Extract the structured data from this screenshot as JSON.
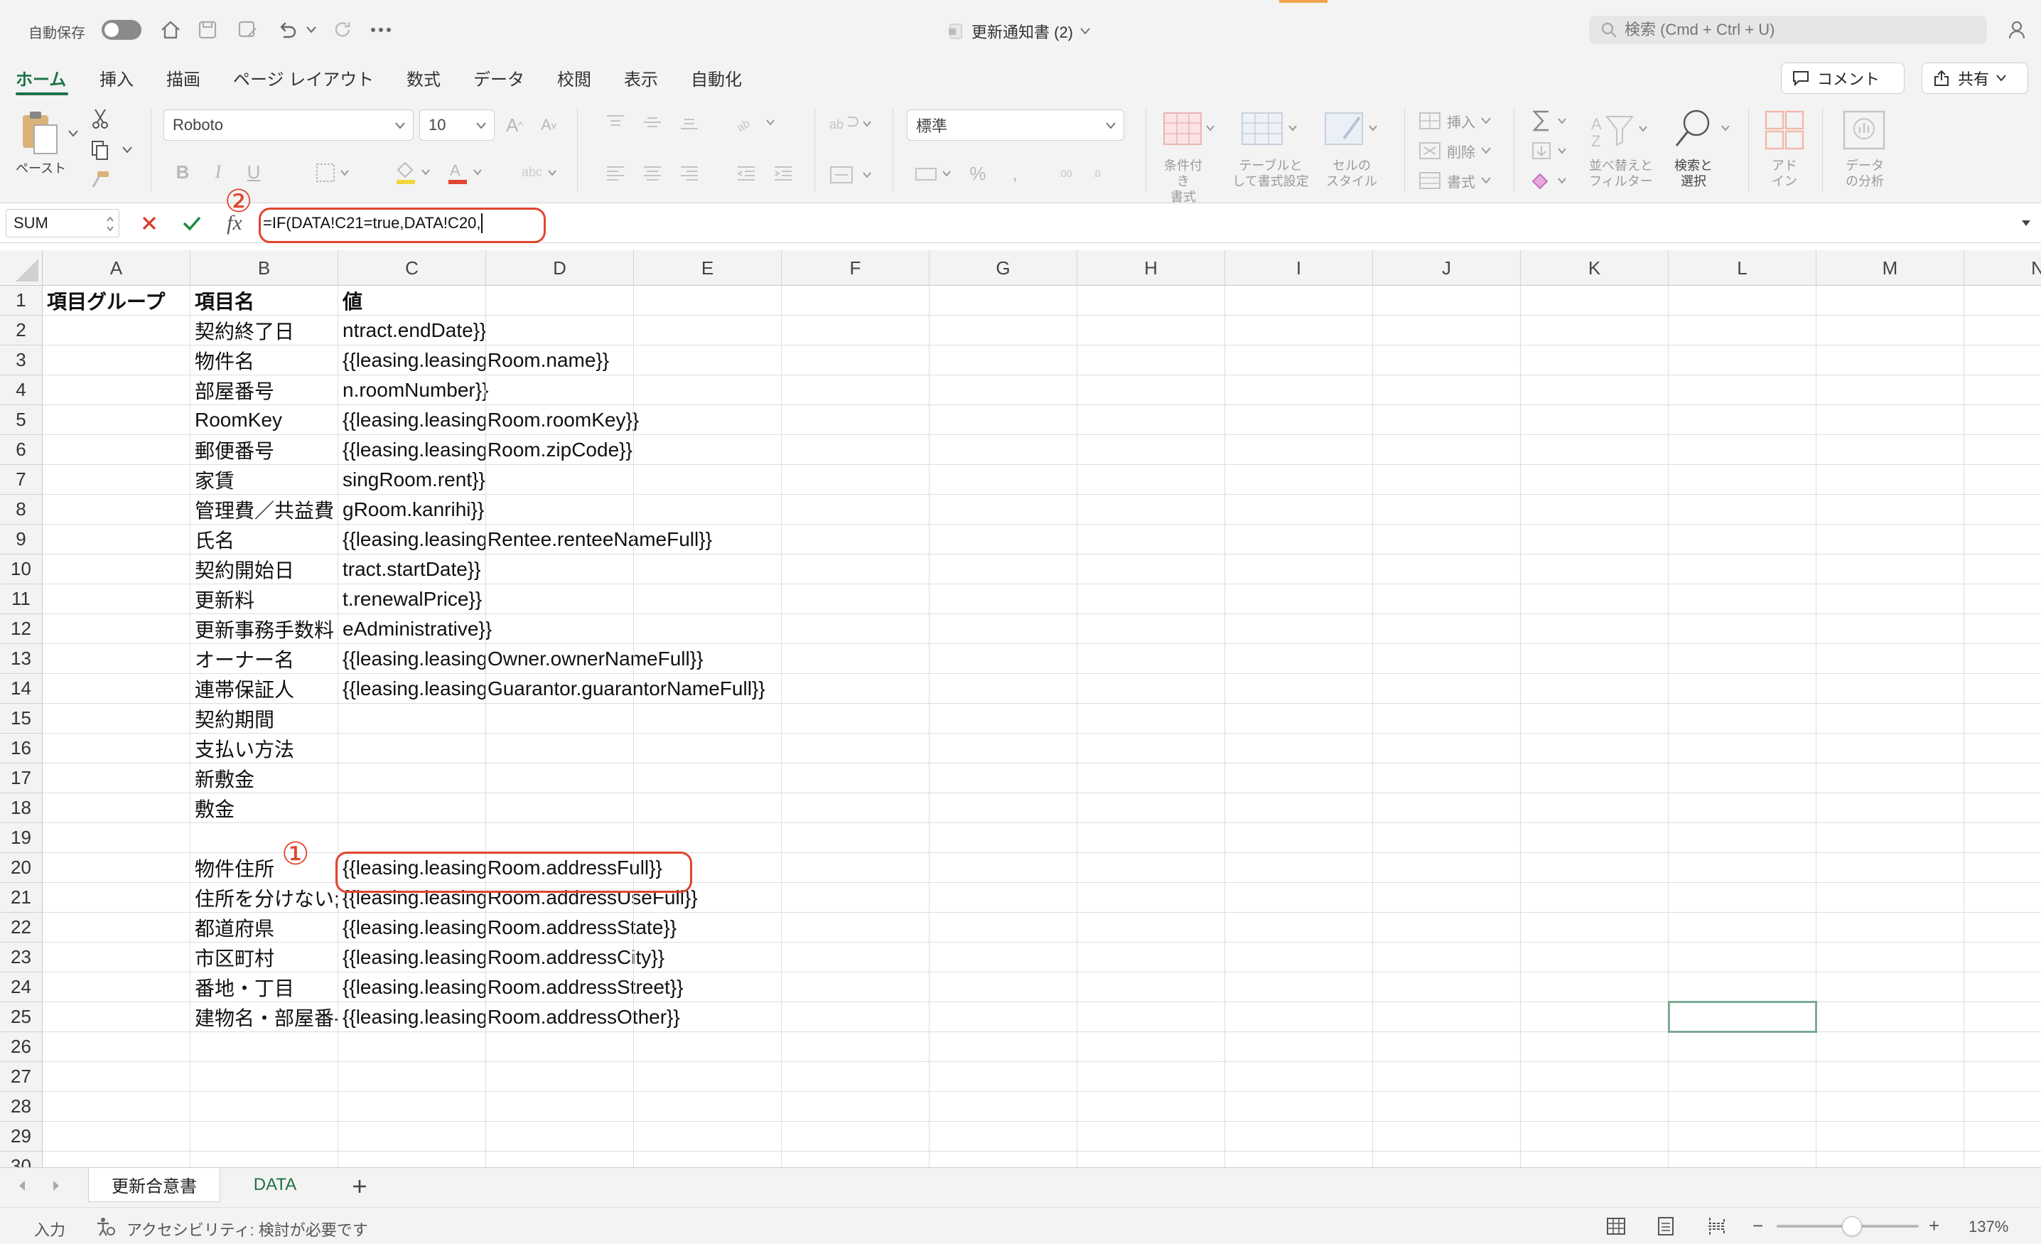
{
  "titlebar": {
    "autosave_label": "自動保存",
    "document_title": "更新通知書 (2)",
    "search_placeholder": "検索 (Cmd + Ctrl + U)"
  },
  "ribbon_tabs": [
    "ホーム",
    "挿入",
    "描画",
    "ページ レイアウト",
    "数式",
    "データ",
    "校閲",
    "表示",
    "自動化"
  ],
  "ribbon_actions": {
    "comment": "コメント",
    "share": "共有"
  },
  "ribbon": {
    "paste_label": "ペースト",
    "font_name": "Roboto",
    "font_size": "10",
    "number_format": "標準",
    "conditional_format": [
      "条件付き",
      "書式"
    ],
    "table_format": [
      "テーブルと",
      "して書式設定"
    ],
    "cell_style": [
      "セルの",
      "スタイル"
    ],
    "insert": "挿入",
    "delete": "削除",
    "format": "書式",
    "sort_filter": [
      "並べ替えと",
      "フィルター"
    ],
    "find_select": [
      "検索と",
      "選択"
    ],
    "addin": [
      "アド",
      "イン"
    ],
    "analyze": [
      "データ",
      "の分析"
    ]
  },
  "formula_bar": {
    "name_box": "SUM",
    "fx": "fx",
    "formula": "=IF(DATA!C21=true,DATA!C20,"
  },
  "annotations": {
    "one": "①",
    "two": "②"
  },
  "columns": [
    "A",
    "B",
    "C",
    "D",
    "E",
    "F",
    "G",
    "H",
    "I",
    "J",
    "K",
    "L",
    "M",
    "N"
  ],
  "rows": [
    {
      "n": "1",
      "a": "項目グループ",
      "b": "項目名",
      "c": "値"
    },
    {
      "n": "2",
      "a": "",
      "b": "契約終了日",
      "c": "ntract.endDate}}"
    },
    {
      "n": "3",
      "a": "",
      "b": "物件名",
      "c": "{{leasing.leasingRoom.name}}"
    },
    {
      "n": "4",
      "a": "",
      "b": "部屋番号",
      "c": "n.roomNumber}}"
    },
    {
      "n": "5",
      "a": "",
      "b": "RoomKey",
      "c": "{{leasing.leasingRoom.roomKey}}"
    },
    {
      "n": "6",
      "a": "",
      "b": "郵便番号",
      "c": "{{leasing.leasingRoom.zipCode}}"
    },
    {
      "n": "7",
      "a": "",
      "b": "家賃",
      "c": "singRoom.rent}}"
    },
    {
      "n": "8",
      "a": "",
      "b": "管理費／共益費",
      "c": "gRoom.kanrihi}}"
    },
    {
      "n": "9",
      "a": "",
      "b": "氏名",
      "c": "{{leasing.leasingRentee.renteeNameFull}}"
    },
    {
      "n": "10",
      "a": "",
      "b": "契約開始日",
      "c": "tract.startDate}}"
    },
    {
      "n": "11",
      "a": "",
      "b": "更新料",
      "c": "t.renewalPrice}}"
    },
    {
      "n": "12",
      "a": "",
      "b": "更新事務手数料",
      "c": "eAdministrative}}"
    },
    {
      "n": "13",
      "a": "",
      "b": "オーナー名",
      "c": "{{leasing.leasingOwner.ownerNameFull}}"
    },
    {
      "n": "14",
      "a": "",
      "b": "連帯保証人",
      "c": "{{leasing.leasingGuarantor.guarantorNameFull}}"
    },
    {
      "n": "15",
      "a": "",
      "b": "契約期間",
      "c": ""
    },
    {
      "n": "16",
      "a": "",
      "b": "支払い方法",
      "c": ""
    },
    {
      "n": "17",
      "a": "",
      "b": "新敷金",
      "c": ""
    },
    {
      "n": "18",
      "a": "",
      "b": "敷金",
      "c": ""
    },
    {
      "n": "19",
      "a": "",
      "b": "",
      "c": ""
    },
    {
      "n": "20",
      "a": "",
      "b": "物件住所",
      "c": "{{leasing.leasingRoom.addressFull}}"
    },
    {
      "n": "21",
      "a": "",
      "b": "住所を分けない;",
      "c": "{{leasing.leasingRoom.addressUseFull}}"
    },
    {
      "n": "22",
      "a": "",
      "b": "都道府県",
      "c": "{{leasing.leasingRoom.addressState}}"
    },
    {
      "n": "23",
      "a": "",
      "b": "市区町村",
      "c": "{{leasing.leasingRoom.addressCity}}"
    },
    {
      "n": "24",
      "a": "",
      "b": "番地・丁目",
      "c": "{{leasing.leasingRoom.addressStreet}}"
    },
    {
      "n": "25",
      "a": "",
      "b": "建物名・部屋番-",
      "c": "{{leasing.leasingRoom.addressOther}}"
    },
    {
      "n": "26",
      "a": "",
      "b": "",
      "c": ""
    },
    {
      "n": "27",
      "a": "",
      "b": "",
      "c": ""
    },
    {
      "n": "28",
      "a": "",
      "b": "",
      "c": ""
    },
    {
      "n": "29",
      "a": "",
      "b": "",
      "c": ""
    },
    {
      "n": "30",
      "a": "",
      "b": "",
      "c": ""
    }
  ],
  "sheet_tabs": [
    "更新合意書",
    "DATA"
  ],
  "active_sheet": "DATA",
  "status": {
    "mode": "入力",
    "accessibility": "アクセシビリティ: 検討が必要です",
    "zoom": "137%",
    "zoom_minus": "−",
    "zoom_plus": "+"
  },
  "colors": {
    "accent": "#1e7145",
    "annotation": "#e0452f"
  }
}
